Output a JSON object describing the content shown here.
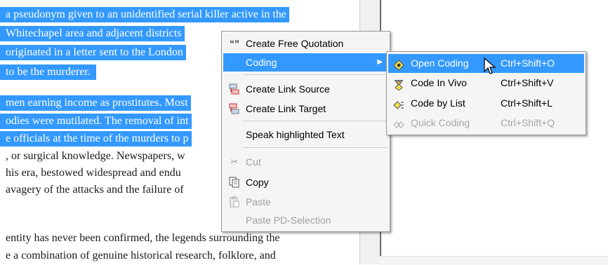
{
  "document": {
    "lines": [
      {
        "text": "a pseudonym given to an unidentified serial killer active in the",
        "selected": true
      },
      {
        "text": "Whitechapel area and adjacent districts",
        "selected": true
      },
      {
        "text": "originated in a letter sent to the London",
        "selected": true
      },
      {
        "text": "to be the murderer.",
        "selected": true
      },
      {
        "text": "men earning income as prostitutes. Most",
        "selected": true
      },
      {
        "text": "odies were mutilated. The removal of int",
        "selected": true
      },
      {
        "text": "e officials at the time of the murders to p",
        "selected": true
      },
      {
        "text": ", or surgical knowledge. Newspapers, w",
        "selected": false
      },
      {
        "text": "his era, bestowed widespread and endu",
        "selected": false
      },
      {
        "text": "avagery of the attacks and the failure of",
        "selected": false
      },
      {
        "text": "entity has never been confirmed, the legends surrounding the",
        "selected": false
      },
      {
        "text": "e a combination of genuine historical research, folklore, and",
        "selected": false
      }
    ]
  },
  "context_menu": {
    "create_free_quotation": {
      "label": "Create Free Quotation",
      "icon": "quote-icon"
    },
    "coding": {
      "label": "Coding",
      "arrow": "▶"
    },
    "create_link_source": {
      "label": "Create Link Source",
      "icon": "link-source-icon"
    },
    "create_link_target": {
      "label": "Create Link Target",
      "icon": "link-target-icon"
    },
    "speak_highlighted_text": {
      "label": "Speak highlighted Text"
    },
    "cut": {
      "label": "Cut",
      "icon": "scissors-icon",
      "enabled": false
    },
    "copy": {
      "label": "Copy",
      "icon": "copy-icon",
      "enabled": true
    },
    "paste": {
      "label": "Paste",
      "icon": "clipboard-icon",
      "enabled": false
    },
    "paste_pd_selection": {
      "label": "Paste PD-Selection",
      "enabled": false
    }
  },
  "coding_submenu": {
    "open_coding": {
      "label": "Open Coding",
      "shortcut": "Ctrl+Shift+O",
      "icon": "open-coding-icon"
    },
    "code_in_vivo": {
      "label": "Code In Vivo",
      "shortcut": "Ctrl+Shift+V",
      "icon": "code-in-vivo-icon"
    },
    "code_by_list": {
      "label": "Code by List",
      "shortcut": "Ctrl+Shift+L",
      "icon": "code-by-list-icon"
    },
    "quick_coding": {
      "label": "Quick Coding",
      "shortcut": "Ctrl+Shift+Q",
      "icon": "quick-coding-icon",
      "enabled": false
    }
  },
  "colors": {
    "selection": "#3399ff",
    "menu_background": "#f5f5f5",
    "disabled_text": "#a0a0a0"
  }
}
